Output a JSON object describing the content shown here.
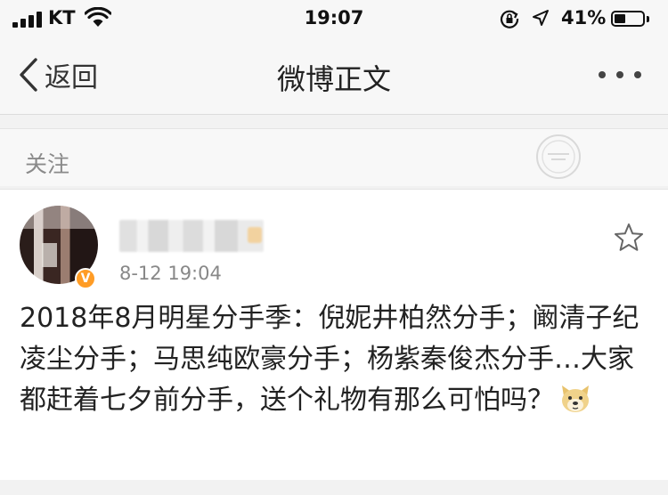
{
  "status_bar": {
    "carrier": "KT",
    "time": "19:07",
    "battery_percent": "41%",
    "battery_level": 0.41
  },
  "nav": {
    "back_label": "返回",
    "title": "微博正文",
    "more_icon": "more-dots-icon"
  },
  "follow": {
    "label": "关注"
  },
  "post": {
    "timestamp": "8-12 19:04",
    "text": "2018年8月明星分手季：倪妮井柏然分手；阚清子纪凌尘分手；马思纯欧豪分手；杨紫秦俊杰分手…大家都赶着七夕前分手，送个礼物有那么可怕吗？",
    "star_icon": "star-outline-icon",
    "verified_badge": "V",
    "emoji": "doge-emoji"
  }
}
